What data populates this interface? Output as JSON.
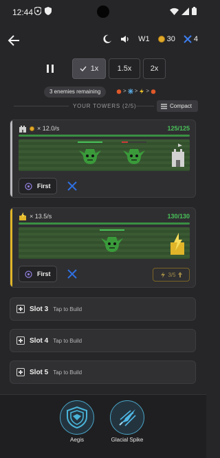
{
  "status_bar": {
    "time": "12:44"
  },
  "topbar": {
    "wave": "W1",
    "coins": "30",
    "lives": "4"
  },
  "speed": {
    "options": [
      "1x",
      "1.5x",
      "2x"
    ],
    "selected": "1x"
  },
  "enemies": {
    "remaining_label": "3 enemies remaining"
  },
  "towers_section": {
    "title": "YOUR TOWERS (2/5)",
    "compact_label": "Compact"
  },
  "towers": [
    {
      "rate": "× 12.0/s",
      "hp": "125/125",
      "hp_fraction": 1.0,
      "accent": "#b9b9bd",
      "target": "First"
    },
    {
      "rate": "× 13.5/s",
      "hp": "130/130",
      "hp_fraction": 1.0,
      "accent": "#e0b529",
      "target": "First",
      "upgrade": "3/5"
    }
  ],
  "slots": [
    {
      "name": "Slot 3",
      "hint": "Tap to Build"
    },
    {
      "name": "Slot 4",
      "hint": "Tap to Build"
    },
    {
      "name": "Slot 5",
      "hint": "Tap to Build"
    }
  ],
  "abilities": [
    {
      "name": "Aegis",
      "icon": "shield-icon"
    },
    {
      "name": "Glacial Spike",
      "icon": "ice-spike-icon"
    }
  ],
  "colors": {
    "accent_blue": "#2f6fe0",
    "hp_green": "#49c25a",
    "gold": "#e0b529"
  }
}
